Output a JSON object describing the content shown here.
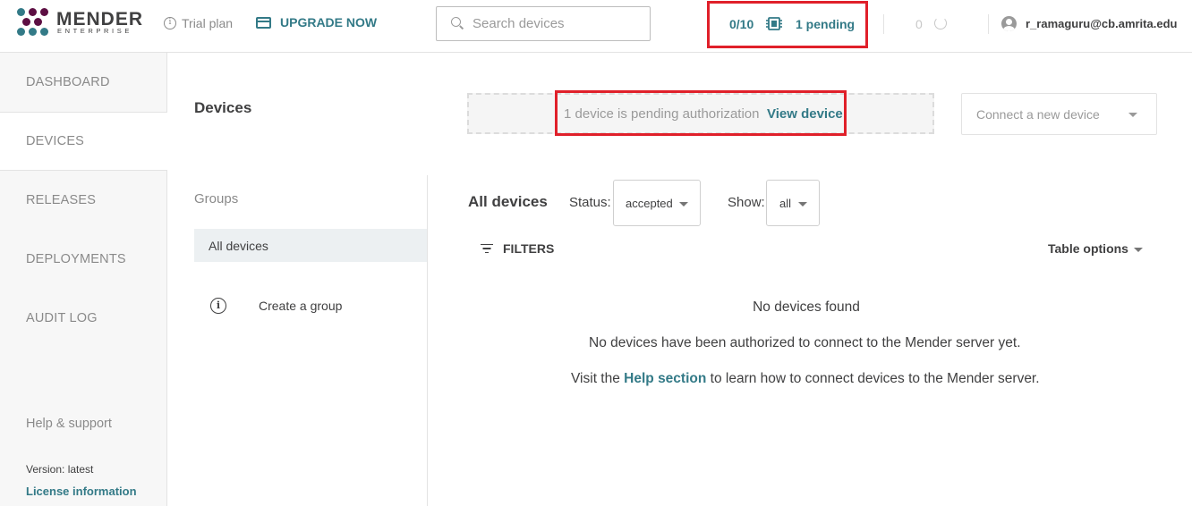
{
  "header": {
    "logo_name": "MENDER",
    "logo_sub": "ENTERPRISE",
    "trial_label": "Trial plan",
    "upgrade_label": "UPGRADE NOW",
    "search_placeholder": "Search devices",
    "device_count": "0/10",
    "pending_label": "1 pending",
    "deployment_count": "0",
    "user_email": "r_ramaguru@cb.amrita.edu"
  },
  "sidebar": {
    "items": [
      {
        "label": "DASHBOARD",
        "active": false
      },
      {
        "label": "DEVICES",
        "active": true
      },
      {
        "label": "RELEASES",
        "active": false
      },
      {
        "label": "DEPLOYMENTS",
        "active": false
      },
      {
        "label": "AUDIT LOG",
        "active": false
      }
    ],
    "help_label": "Help & support",
    "version_label": "Version: latest",
    "license_label": "License information"
  },
  "main": {
    "page_title": "Devices",
    "notice_text": "1 device is pending authorization",
    "notice_link": "View device",
    "connect_label": "Connect a new device",
    "groups_label": "Groups",
    "group_all_label": "All devices",
    "create_group_label": "Create a group",
    "list_title": "All devices",
    "status_label": "Status:",
    "status_value": "accepted",
    "show_label": "Show:",
    "show_value": "all",
    "filters_label": "FILTERS",
    "table_options_label": "Table options",
    "empty_title": "No devices found",
    "empty_line1": "No devices have been authorized to connect to the Mender server yet.",
    "empty_line2_prefix": "Visit the ",
    "empty_line2_link": "Help section",
    "empty_line2_suffix": " to learn how to connect devices to the Mender server."
  },
  "colors": {
    "accent": "#337a87",
    "brand_purple": "#5d0f43",
    "brand_teal": "#337a87",
    "highlight_red": "#e0202a"
  }
}
